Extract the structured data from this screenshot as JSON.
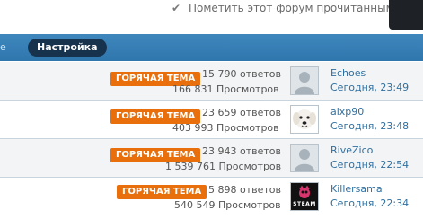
{
  "header": {
    "mark_read_label": "Пометить этот форум прочитанным",
    "mark_read_icon": "check-icon"
  },
  "nav": {
    "edge_label": "е",
    "active_tab": "Настройка"
  },
  "threads": [
    {
      "badge": "ГОРЯЧАЯ ТЕМА",
      "replies": "15 790 ответов",
      "views": "166 831 Просмотров",
      "avatar": "default-avatar-icon",
      "user": "Echoes",
      "date": "Сегодня, 23:49"
    },
    {
      "badge": "ГОРЯЧАЯ ТЕМА",
      "replies": "23 659 ответов",
      "views": "403 993 Просмотров",
      "avatar": "dog-avatar-icon",
      "user": "alxp90",
      "date": "Сегодня, 23:48"
    },
    {
      "badge": "ГОРЯЧАЯ ТЕМА",
      "replies": "23 943 ответов",
      "views": "1 539 761 Просмотров",
      "avatar": "default-avatar-icon",
      "user": "RiveZico",
      "date": "Сегодня, 22:54"
    },
    {
      "badge": "ГОРЯЧАЯ ТЕМА",
      "replies": "5 898 ответов",
      "views": "540 549 Просмотров",
      "avatar": "steam-avatar-icon",
      "user": "Killersama",
      "date": "Сегодня, 22:34",
      "avatar_caption": "STEAM"
    }
  ],
  "colors": {
    "badge": "#e86f0c",
    "navbar": "#2f76ad",
    "link": "#2f6f9f"
  }
}
